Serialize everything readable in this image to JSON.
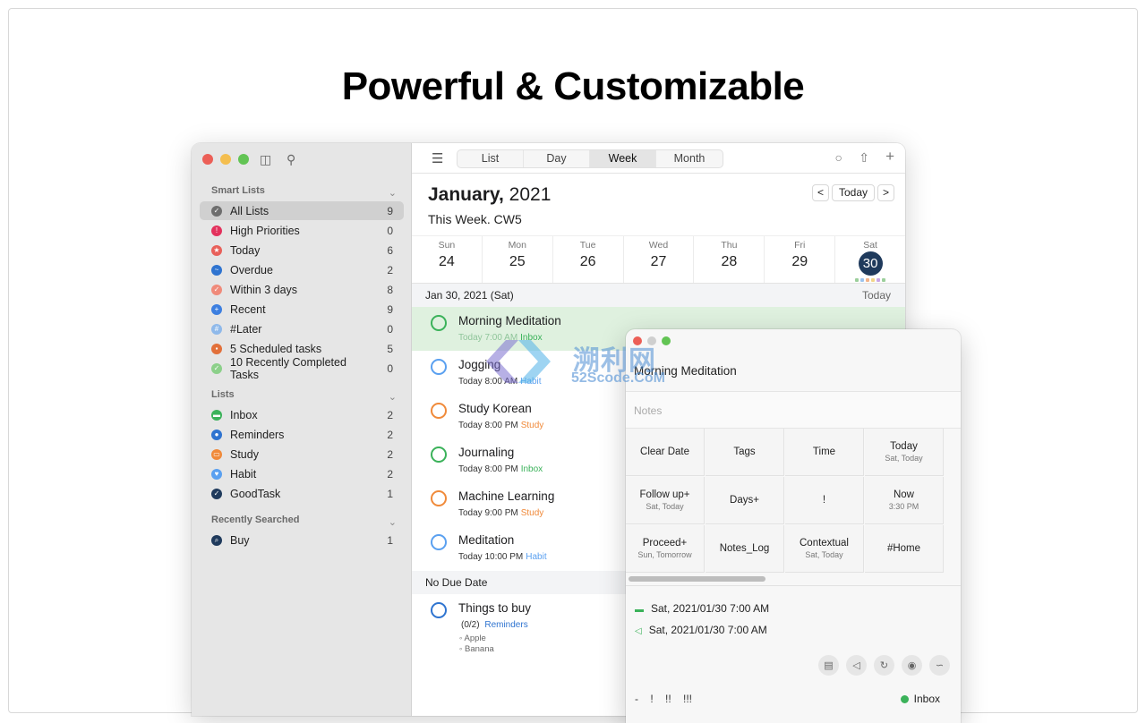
{
  "headline": "Powerful & Customizable",
  "sidebar": {
    "smart_lists_label": "Smart Lists",
    "smart_lists": [
      {
        "label": "All Lists",
        "count": "9",
        "color": "#6e6e6e",
        "icon": "check-circle-icon",
        "selected": true
      },
      {
        "label": "High Priorities",
        "count": "0",
        "color": "#e3315c",
        "icon": "exclamation-icon"
      },
      {
        "label": "Today",
        "count": "6",
        "color": "#e8605a",
        "icon": "star-icon"
      },
      {
        "label": "Overdue",
        "count": "2",
        "color": "#2f74d0",
        "icon": "wave-icon"
      },
      {
        "label": "Within 3 days",
        "count": "8",
        "color": "#f08a7a",
        "icon": "check-icon"
      },
      {
        "label": "Recent",
        "count": "9",
        "color": "#3d7fe0",
        "icon": "plus-icon"
      },
      {
        "label": "#Later",
        "count": "0",
        "color": "#8fb9ea",
        "icon": "hash-icon"
      },
      {
        "label": "5 Scheduled tasks",
        "count": "5",
        "color": "#e2703a",
        "icon": "calendar-icon"
      },
      {
        "label": "10 Recently Completed Tasks",
        "count": "0",
        "color": "#8cd08a",
        "icon": "check-icon"
      }
    ],
    "lists_label": "Lists",
    "lists": [
      {
        "label": "Inbox",
        "count": "2",
        "color": "#3bb25a",
        "icon": "tray-icon"
      },
      {
        "label": "Reminders",
        "count": "2",
        "color": "#2f74d0",
        "icon": "dot-icon"
      },
      {
        "label": "Study",
        "count": "2",
        "color": "#f08a3a",
        "icon": "book-icon"
      },
      {
        "label": "Habit",
        "count": "2",
        "color": "#5aa0f0",
        "icon": "heart-icon"
      },
      {
        "label": "GoodTask",
        "count": "1",
        "color": "#1f3a5c",
        "icon": "check-icon"
      }
    ],
    "recent_label": "Recently Searched",
    "recent": [
      {
        "label": "Buy",
        "count": "1",
        "color": "#1f3a5c",
        "icon": "search-icon"
      }
    ]
  },
  "toolbar": {
    "tabs": [
      "List",
      "Day",
      "Week",
      "Month"
    ],
    "active_tab": "Week"
  },
  "header": {
    "month": "January,",
    "year": " 2021",
    "week_info": "This Week. CW5",
    "prev": "<",
    "today": "Today",
    "next": ">"
  },
  "week": [
    {
      "name": "Sun",
      "num": "24"
    },
    {
      "name": "Mon",
      "num": "25"
    },
    {
      "name": "Tue",
      "num": "26"
    },
    {
      "name": "Wed",
      "num": "27"
    },
    {
      "name": "Thu",
      "num": "28"
    },
    {
      "name": "Fri",
      "num": "29"
    },
    {
      "name": "Sat",
      "num": "30",
      "current": true
    }
  ],
  "section_date": {
    "label": "Jan 30, 2021 (Sat)",
    "right": "Today"
  },
  "tasks": [
    {
      "title": "Morning Meditation",
      "time": "Today 7:00 AM",
      "list": "Inbox",
      "list_color": "#3bb25a",
      "circle": "#3bb25a",
      "highlight": true
    },
    {
      "title": "Jogging",
      "time": "Today 8:00 AM",
      "list": "Habit",
      "list_color": "#5aa0f0",
      "circle": "#5aa0f0"
    },
    {
      "title": "Study Korean",
      "time": "Today 8:00 PM",
      "list": "Study",
      "list_color": "#f08a3a",
      "circle": "#f08a3a"
    },
    {
      "title": "Journaling",
      "time": "Today 8:00 PM",
      "list": "Inbox",
      "list_color": "#3bb25a",
      "circle": "#3bb25a"
    },
    {
      "title": "Machine Learning",
      "time": "Today 9:00 PM",
      "list": "Study",
      "list_color": "#f08a3a",
      "circle": "#f08a3a"
    },
    {
      "title": "Meditation",
      "time": "Today 10:00 PM",
      "list": "Habit",
      "list_color": "#5aa0f0",
      "circle": "#5aa0f0"
    }
  ],
  "no_due": {
    "label": "No Due Date",
    "task_title": "Things to buy",
    "task_progress": "(0/2)",
    "task_list": "Reminders",
    "task_list_color": "#2f74d0",
    "subtasks": [
      "Apple",
      "Banana"
    ]
  },
  "detail": {
    "title": "Morning Meditation",
    "notes_placeholder": "Notes",
    "actions": [
      {
        "label": "Clear Date",
        "sub": ""
      },
      {
        "label": "Tags",
        "sub": ""
      },
      {
        "label": "Time",
        "sub": ""
      },
      {
        "label": "Today",
        "sub": "Sat, Today"
      },
      {
        "label": "Follow up+",
        "sub": "Sat, Today"
      },
      {
        "label": "Days+",
        "sub": ""
      },
      {
        "label": "!",
        "sub": ""
      },
      {
        "label": "Now",
        "sub": "3:30 PM"
      },
      {
        "label": "Proceed+",
        "sub": "Sun, Tomorrow"
      },
      {
        "label": "Notes_Log",
        "sub": ""
      },
      {
        "label": "Contextual",
        "sub": "Sat, Today"
      },
      {
        "label": "#Home",
        "sub": ""
      }
    ],
    "due_line": "Sat, 2021/01/30 7:00 AM",
    "alarm_line": "Sat, 2021/01/30 7:00 AM",
    "priorities": "-    !    !!    !!!",
    "list_name": "Inbox"
  },
  "watermark": {
    "text": "溯利网",
    "sub": "52Scode.CoM"
  }
}
